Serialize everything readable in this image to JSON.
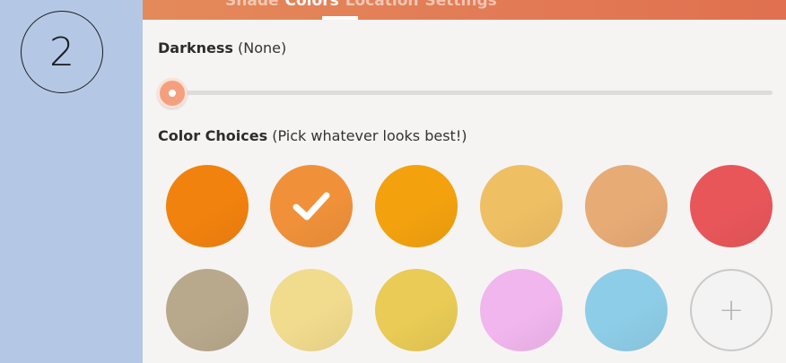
{
  "step": {
    "number": "2"
  },
  "tabs": [
    {
      "label": "Shade",
      "active": false
    },
    {
      "label": "Colors",
      "active": true
    },
    {
      "label": "Location",
      "active": false
    },
    {
      "label": "Settings",
      "active": false
    }
  ],
  "darkness": {
    "title": "Darkness",
    "value_text": "(None)",
    "level": 0
  },
  "color_choices": {
    "title": "Color Choices",
    "hint": "(Pick whatever looks best!)",
    "selected_index": 1,
    "add_label": "+",
    "swatches": [
      {
        "color": "#f2820e"
      },
      {
        "color": "#f0913a"
      },
      {
        "color": "#f3a20e"
      },
      {
        "color": "#efbf64"
      },
      {
        "color": "#e7ab76"
      },
      {
        "color": "#e8565a"
      },
      {
        "color": "#b9a98c"
      },
      {
        "color": "#f1db8d"
      },
      {
        "color": "#e9cb55"
      },
      {
        "color": "#f1b6ee"
      },
      {
        "color": "#8ecde7"
      }
    ]
  }
}
